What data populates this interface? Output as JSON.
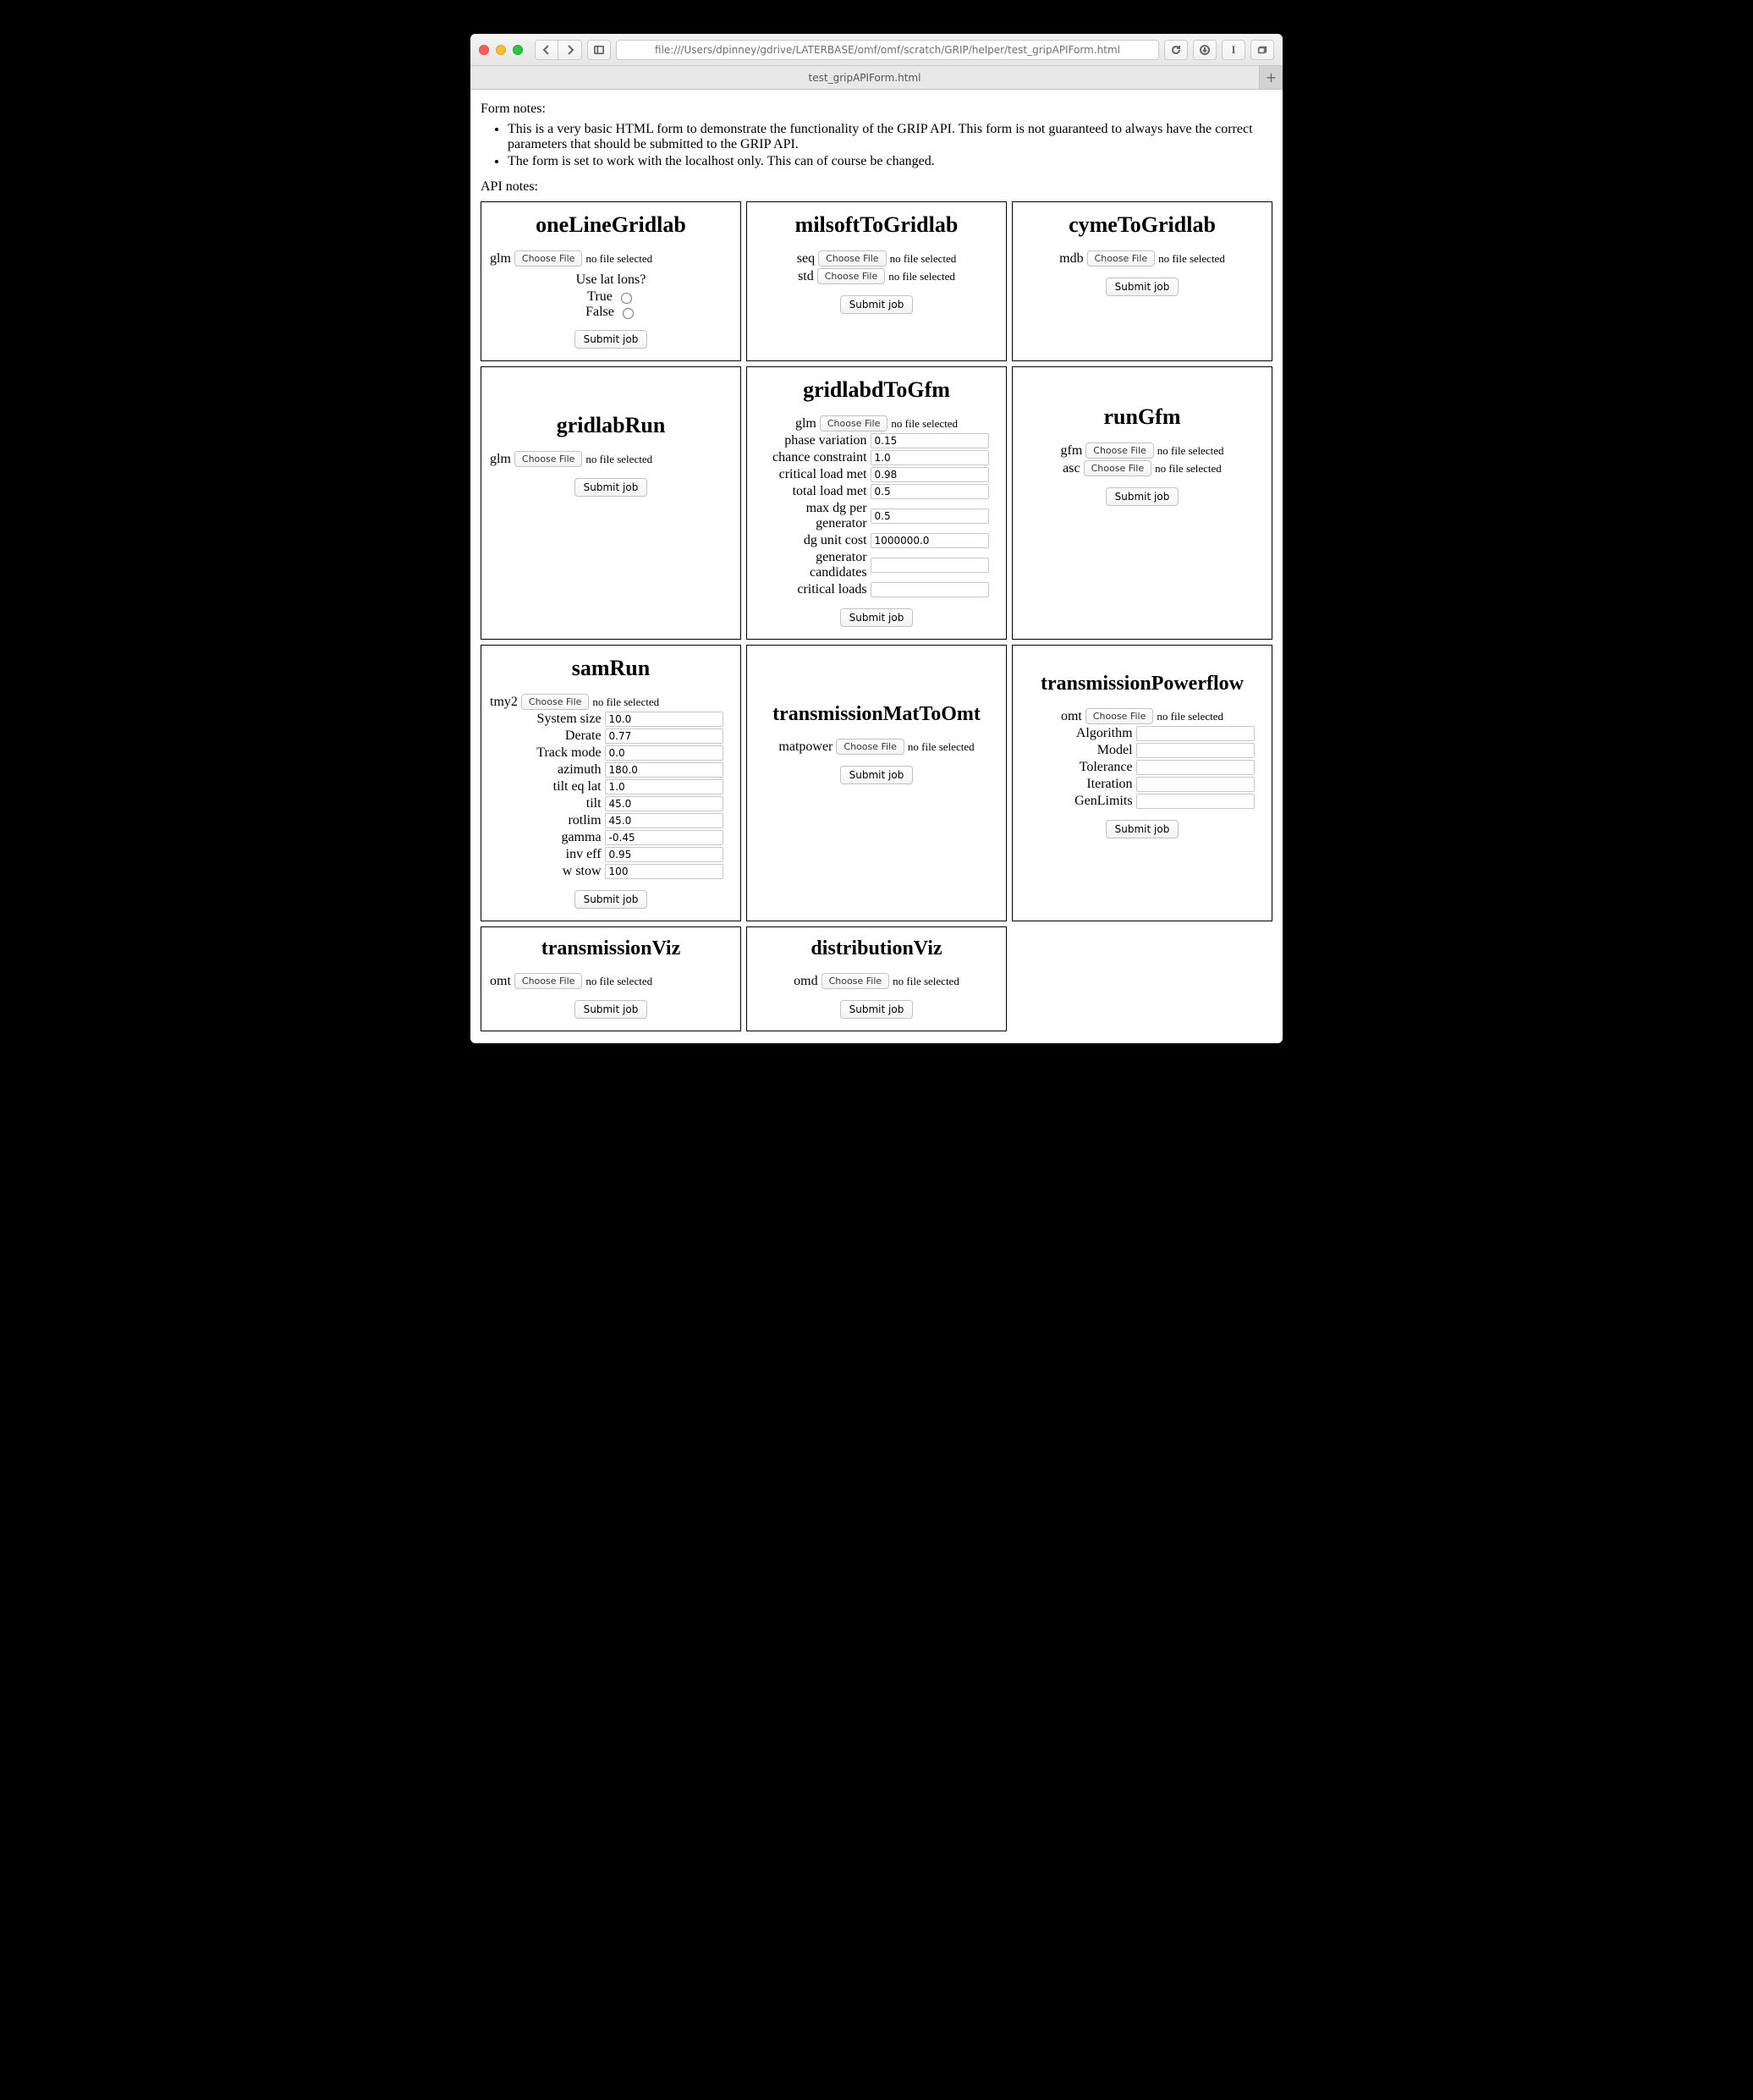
{
  "browser": {
    "url": "file:///Users/dpinney/gdrive/LATERBASE/omf/omf/scratch/GRIP/helper/test_gripAPIForm.html",
    "tab_title": "test_gripAPIForm.html"
  },
  "ui": {
    "choose_file": "Choose File",
    "no_file_selected": "no file selected",
    "submit": "Submit job"
  },
  "notes": {
    "form_heading": "Form notes:",
    "api_heading": "API notes:",
    "bullet1": "This is a very basic HTML form to demonstrate the functionality of the GRIP API. This form is not guaranteed to always have the correct parameters that should be submitted to the GRIP API.",
    "bullet2": "The form is set to work with the localhost only. This can of course be changed."
  },
  "cells": {
    "oneLineGridlab": {
      "title": "oneLineGridlab",
      "file_label": "glm",
      "question": "Use lat lons?",
      "opt_true": "True",
      "opt_false": "False"
    },
    "milsoftToGridlab": {
      "title": "milsoftToGridlab",
      "file1_label": "seq",
      "file2_label": "std"
    },
    "cymeToGridlab": {
      "title": "cymeToGridlab",
      "file_label": "mdb"
    },
    "gridlabRun": {
      "title": "gridlabRun",
      "file_label": "glm"
    },
    "gridlabdToGfm": {
      "title": "gridlabdToGfm",
      "file_label": "glm",
      "fields": [
        {
          "label": "phase variation",
          "value": "0.15"
        },
        {
          "label": "chance constraint",
          "value": "1.0"
        },
        {
          "label": "critical load met",
          "value": "0.98"
        },
        {
          "label": "total load met",
          "value": "0.5"
        },
        {
          "label": "max dg per generator",
          "value": "0.5"
        },
        {
          "label": "dg unit cost",
          "value": "1000000.0"
        },
        {
          "label": "generator candidates",
          "value": ""
        },
        {
          "label": "critical loads",
          "value": ""
        }
      ]
    },
    "runGfm": {
      "title": "runGfm",
      "file1_label": "gfm",
      "file2_label": "asc"
    },
    "samRun": {
      "title": "samRun",
      "file_label": "tmy2",
      "fields": [
        {
          "label": "System size",
          "value": "10.0"
        },
        {
          "label": "Derate",
          "value": "0.77"
        },
        {
          "label": "Track mode",
          "value": "0.0"
        },
        {
          "label": "azimuth",
          "value": "180.0"
        },
        {
          "label": "tilt eq lat",
          "value": "1.0"
        },
        {
          "label": "tilt",
          "value": "45.0"
        },
        {
          "label": "rotlim",
          "value": "45.0"
        },
        {
          "label": "gamma",
          "value": "-0.45"
        },
        {
          "label": "inv eff",
          "value": "0.95"
        },
        {
          "label": "w stow",
          "value": "100"
        }
      ]
    },
    "transmissionMatToOmt": {
      "title": "transmissionMatToOmt",
      "file_label": "matpower"
    },
    "transmissionPowerflow": {
      "title": "transmissionPowerflow",
      "file_label": "omt",
      "fields": [
        {
          "label": "Algorithm",
          "value": ""
        },
        {
          "label": "Model",
          "value": ""
        },
        {
          "label": "Tolerance",
          "value": ""
        },
        {
          "label": "Iteration",
          "value": ""
        },
        {
          "label": "GenLimits",
          "value": ""
        }
      ]
    },
    "transmissionViz": {
      "title": "transmissionViz",
      "file_label": "omt"
    },
    "distributionViz": {
      "title": "distributionViz",
      "file_label": "omd"
    }
  }
}
